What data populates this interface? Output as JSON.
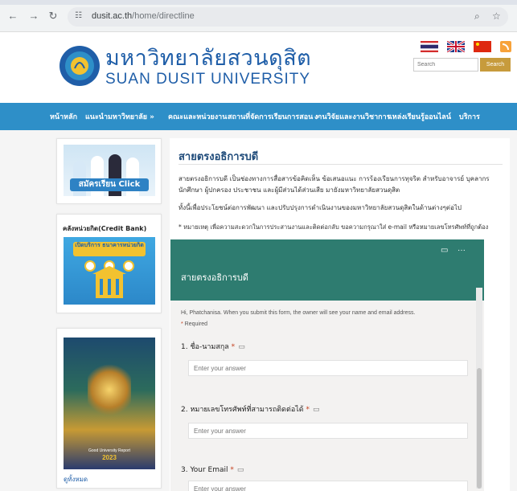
{
  "browser": {
    "back_icon": "back-arrow-icon",
    "forward_icon": "forward-arrow-icon",
    "reload_icon": "reload-icon",
    "site_info_icon": "tune-icon",
    "url_host": "dusit.ac.th",
    "url_path": "/home/directline",
    "zoom_icon": "zoom-icon",
    "bookmark_icon": "star-icon"
  },
  "header": {
    "title_th": "มหาวิทยาลัยสวนดุสิต",
    "title_en": "SUAN DUSIT UNIVERSITY",
    "languages": [
      "thai-flag-icon",
      "uk-flag-icon",
      "china-flag-icon"
    ],
    "rss_icon": "rss-icon",
    "search_placeholder": "Search",
    "search_button": "Search"
  },
  "nav": {
    "items": [
      "หน้าหลัก",
      "แนะนำมหาวิทยาลัย »",
      "คณะและหน่วยงาน",
      "สถานที่จัดการเรียนการสอน »",
      "งานวิจัยและงานวิชาการ",
      "แหล่งเรียนรู้ออนไลน์",
      "บริการ"
    ]
  },
  "sidebar": {
    "apply_banner_label": "สมัครเรียน Click",
    "credit_bank_title": "คลังหน่วยกิต(Credit Bank)",
    "credit_banner_heading": "เปิดบริการ ธนาคารหน่วยกิต",
    "report_text": "Good University Report",
    "report_year": "2023",
    "see_all": "ดูทั้งหมด"
  },
  "main": {
    "title": "สายตรงอธิการบดี",
    "paragraph1": "สายตรงอธิการบดี เป็นช่องทางการสื่อสารข้อคิดเห็น ข้อเสนอแนะ การร้องเรียนการทุจริต สำหรับอาจารย์ บุคลากร นักศึกษา ผู้ปกครอง ประชาชน และผู้มีส่วนได้ส่วนเสีย มายังมหาวิทยาลัยสวนดุสิต",
    "paragraph2": "ทั้งนี้เพื่อประโยชน์ต่อการพัฒนา และปรับปรุงการดำเนินงานของมหาวิทยาลัยสวนดุสิตในด้านต่างๆต่อไป",
    "note": "* หมายเหตุ เพื่อความสะดวกในการประสานงานและติดต่อกลับ ขอความกรุณาใส่ e-mail หรือหมายเลขโทรศัพท์ที่ถูกต้อง"
  },
  "form": {
    "title": "สายตรงอธิการบดี",
    "header_icons": [
      "immersive-reader-icon",
      "more-icon"
    ],
    "signin_notice": "Hi, Phatchanisa. When you submit this form, the owner will see your name and email address.",
    "required_label": "Required",
    "question_icon": "immersive-reader-icon",
    "questions": [
      {
        "label": "1. ชื่อ-นามสกุล",
        "placeholder": "Enter your answer"
      },
      {
        "label": "2. หมายเลขโทรศัพท์ที่สามารถติดต่อได้",
        "placeholder": "Enter your answer"
      },
      {
        "label": "3. Your Email",
        "placeholder": "Enter your answer"
      }
    ]
  },
  "colors": {
    "nav_blue": "#2e8fc8",
    "form_header_green": "#2e7c70",
    "title_blue": "#1f5ea8",
    "search_gold": "#c79b3c"
  }
}
